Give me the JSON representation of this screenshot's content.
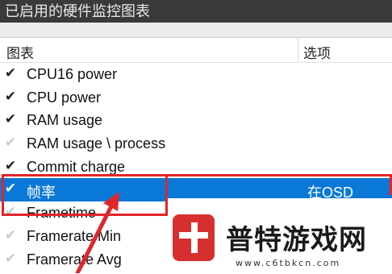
{
  "window": {
    "title": "已启用的硬件监控图表"
  },
  "table": {
    "columns": [
      "图表",
      "选项"
    ],
    "rows": [
      {
        "label": "CPU16 power",
        "checked": true,
        "option": ""
      },
      {
        "label": "CPU power",
        "checked": true,
        "option": ""
      },
      {
        "label": "RAM usage",
        "checked": true,
        "option": ""
      },
      {
        "label": "RAM usage \\ process",
        "checked": false,
        "option": ""
      },
      {
        "label": "Commit charge",
        "checked": true,
        "option": ""
      },
      {
        "label": "帧率",
        "checked": true,
        "option": "在OSD",
        "selected": true
      },
      {
        "label": "Frametime",
        "checked": false,
        "option": ""
      },
      {
        "label": "Framerate Min",
        "checked": false,
        "option": ""
      },
      {
        "label": "Framerate Avg",
        "checked": false,
        "option": ""
      }
    ]
  },
  "watermark": {
    "brand": "普特游戏网",
    "url": "www.c6tbkcn.com"
  },
  "colors": {
    "selection": "#0a78d7",
    "highlight": "#e0262b",
    "titlebar": "#3a3a3a"
  }
}
